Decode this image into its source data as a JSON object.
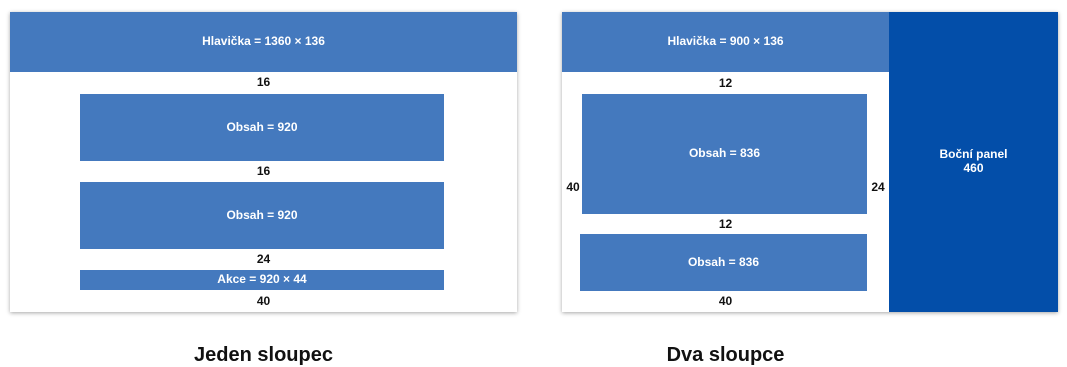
{
  "single_column": {
    "header_label": "Hlavička = 1360 × 136",
    "gap_1": "16",
    "content_1_label": "Obsah = 920",
    "gap_2": "16",
    "content_2_label": "Obsah = 920",
    "gap_3": "24",
    "actions_label": "Akce = 920 × 44",
    "bottom_gap": "40",
    "caption": "Jeden sloupec"
  },
  "two_columns": {
    "header_label": "Hlavička = 900 × 136",
    "gap_1": "12",
    "left_margin": "40",
    "right_gutter": "24",
    "content_1_label": "Obsah = 836",
    "gap_2": "12",
    "content_2_label": "Obsah = 836",
    "bottom_gap": "40",
    "sidebar_line_1": "Boční panel",
    "sidebar_line_2": "460",
    "caption": "Dva sloupce"
  },
  "colors": {
    "block": "#4479be",
    "sidebar": "#034ea9"
  }
}
